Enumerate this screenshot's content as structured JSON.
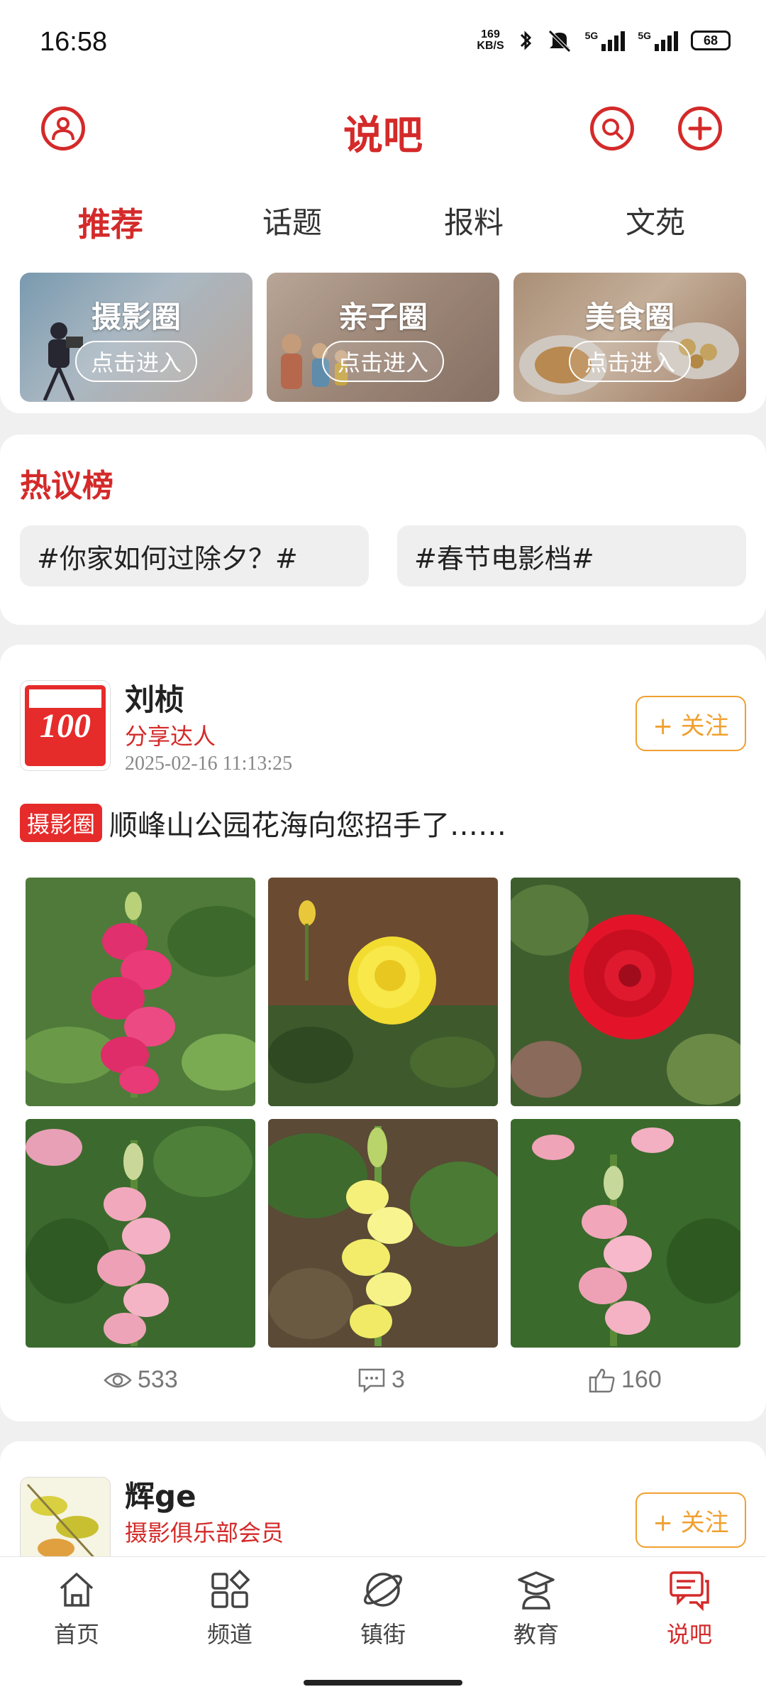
{
  "status_bar": {
    "time": "16:58",
    "net_speed_value": "169",
    "net_speed_unit": "KB/S",
    "sig1_label": "5G",
    "sig2_label": "5G",
    "battery": "68"
  },
  "header": {
    "title": "说吧",
    "icons": [
      "user-icon",
      "search-icon",
      "add-icon"
    ]
  },
  "tabs": [
    {
      "label": "推荐",
      "active": true
    },
    {
      "label": "话题",
      "active": false
    },
    {
      "label": "报料",
      "active": false
    },
    {
      "label": "文苑",
      "active": false
    }
  ],
  "circles": [
    {
      "name": "摄影圈",
      "enter": "点击进入"
    },
    {
      "name": "亲子圈",
      "enter": "点击进入"
    },
    {
      "name": "美食圈",
      "enter": "点击进入"
    }
  ],
  "hot": {
    "title": "热议榜",
    "topics": [
      "#你家如何过除夕？#",
      "#春节电影档#"
    ]
  },
  "post1": {
    "avatar_text": "100",
    "author": "刘桢",
    "role": "分享达人",
    "time": "2025-02-16 11:13:25",
    "follow": "+ 关注",
    "tag": "摄影圈",
    "text": "顺峰山公园花海向您招手了……",
    "views": "533",
    "comments": "3",
    "likes": "160"
  },
  "post2": {
    "author": "辉ge",
    "role": "摄影俱乐部会员",
    "follow": "+ 关注"
  },
  "nav": [
    {
      "label": "首页",
      "icon": "home-icon",
      "active": false
    },
    {
      "label": "频道",
      "icon": "channel-icon",
      "active": false
    },
    {
      "label": "镇街",
      "icon": "planet-icon",
      "active": false
    },
    {
      "label": "教育",
      "icon": "graduation-icon",
      "active": false
    },
    {
      "label": "说吧",
      "icon": "chat-icon",
      "active": true
    }
  ],
  "colors": {
    "accent": "#d42a2a",
    "follow": "#f0a030"
  }
}
